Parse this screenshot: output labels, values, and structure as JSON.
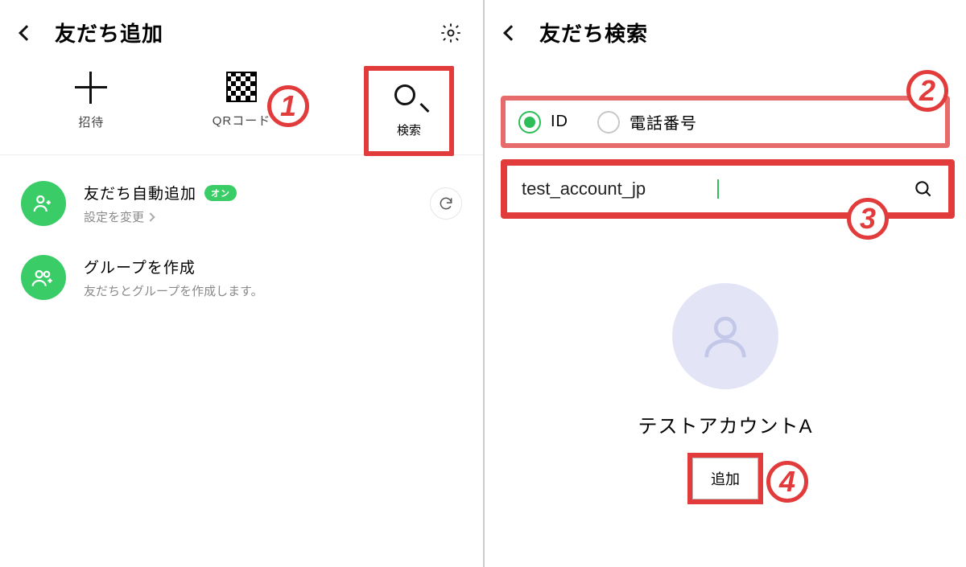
{
  "left": {
    "title": "友だち追加",
    "actions": {
      "invite": "招待",
      "qrcode": "QRコード",
      "search": "検索"
    },
    "rows": {
      "auto_add": {
        "title": "友だち自動追加",
        "badge": "オン",
        "sub": "設定を変更"
      },
      "create_group": {
        "title": "グループを作成",
        "sub": "友だちとグループを作成します。"
      }
    }
  },
  "right": {
    "title": "友だち検索",
    "radio": {
      "id": "ID",
      "phone": "電話番号"
    },
    "search_value": "test_account_jp",
    "result_name": "テストアカウントA",
    "add_button": "追加"
  },
  "markers": {
    "m1": "1",
    "m2": "2",
    "m3": "3",
    "m4": "4"
  }
}
